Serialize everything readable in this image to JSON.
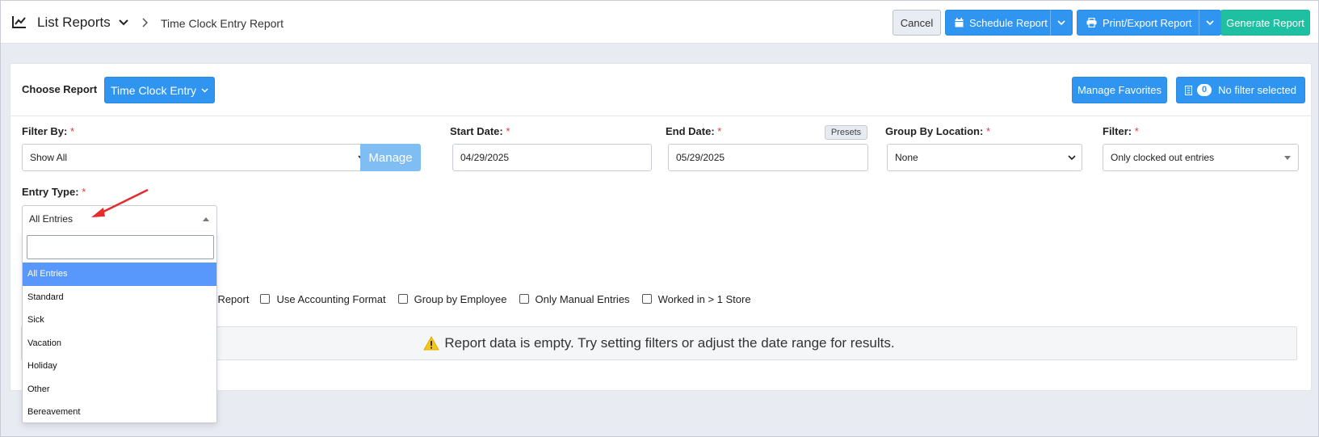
{
  "header": {
    "title": "List Reports",
    "breadcrumb": "Time Clock Entry Report",
    "icons": {
      "chart": "chart-line-icon",
      "chevron": "chevron-down-icon",
      "separator": "chevron-right-icon"
    }
  },
  "toolbar": {
    "cancel_label": "Cancel",
    "schedule_label": "Schedule Report",
    "print_label": "Print/Export Report",
    "generate_label": "Generate Report"
  },
  "report": {
    "choose_label": "Choose Report",
    "selected_report": "Time Clock Entry",
    "manage_favorites": "Manage Favorites",
    "filter_count": "0",
    "filter_status": "No filter selected"
  },
  "filters": {
    "filter_by": {
      "label": "Filter By:",
      "value": "Show All",
      "manage_label": "Manage"
    },
    "start_date": {
      "label": "Start Date:",
      "value": "04/29/2025"
    },
    "end_date": {
      "label": "End Date:",
      "value": "05/29/2025",
      "presets_label": "Presets"
    },
    "group_by_location": {
      "label": "Group By Location:",
      "value": "None"
    },
    "filter": {
      "label": "Filter:",
      "value": "Only clocked out entries"
    },
    "entry_type": {
      "label": "Entry Type:",
      "value": "All Entries",
      "search_placeholder": "",
      "options": [
        "All Entries",
        "Standard",
        "Sick",
        "Vacation",
        "Holiday",
        "Other",
        "Bereavement"
      ],
      "selected_index": 0
    },
    "required_mark": "*"
  },
  "options": {
    "partial_label": "ry Report",
    "accounting": "Use Accounting Format",
    "group_employee": "Group by Employee",
    "manual_entries": "Only Manual Entries",
    "multi_store": "Worked in > 1 Store"
  },
  "message": {
    "empty": "Report data is empty. Try setting filters or adjust the date range for results."
  },
  "colors": {
    "primary": "#2f95f0",
    "success": "#1fc0a1",
    "selected_option": "#5897fb",
    "warning": "#f5c518",
    "annotation_arrow": "#e52b2b"
  }
}
